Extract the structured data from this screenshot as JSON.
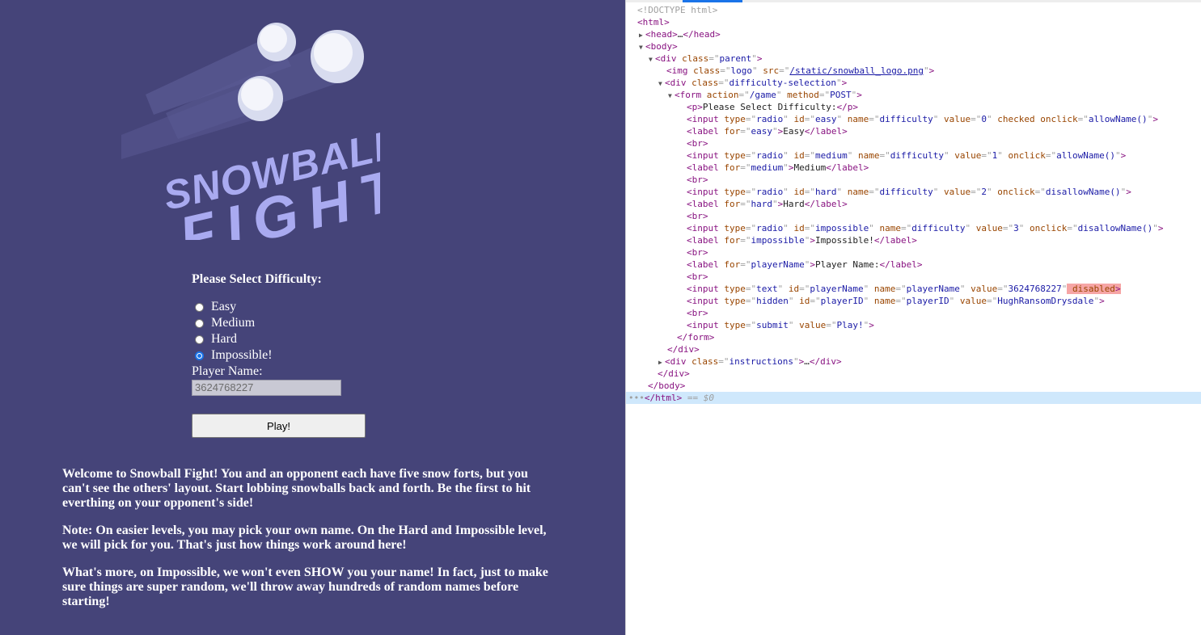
{
  "game": {
    "logo": {
      "line1": "SNOWBALL",
      "line2": "FIGHT"
    },
    "difficulty_prompt": "Please Select Difficulty:",
    "options": [
      {
        "label": "Easy",
        "checked": false
      },
      {
        "label": "Medium",
        "checked": false
      },
      {
        "label": "Hard",
        "checked": false
      },
      {
        "label": "Impossible!",
        "checked": true
      }
    ],
    "player_name_label": "Player Name:",
    "player_name_value": "3624768227",
    "play_button": "Play!",
    "instructions": [
      "Welcome to Snowball Fight! You and an opponent each have five snow forts, but you can't see the others' layout. Start lobbing snowballs back and forth. Be the first to hit everthing on your opponent's side!",
      "Note: On easier levels, you may pick your own name. On the Hard and Impossible level, we will pick for you. That's just how things work around here!",
      "What's more, on Impossible, we won't even SHOW you your name! In fact, just to make sure things are super random, we'll throw away hundreds of random names before starting!"
    ],
    "colors": {
      "background": "#454479",
      "logo": "#a9aaf0",
      "text": "#ffffff",
      "radio_checked": "#1a73e8"
    }
  },
  "devtools": {
    "doctype": "<!DOCTYPE html>",
    "lines": {
      "html_open": "html",
      "head": "head",
      "body_open": "body",
      "div_parent": {
        "tag": "div",
        "attr": "class",
        "value": "parent"
      },
      "img": {
        "tag": "img",
        "a1": "class",
        "v1": "logo",
        "a2": "src",
        "v2": "/static/snowball_logo.png"
      },
      "div_diff": {
        "tag": "div",
        "attr": "class",
        "value": "difficulty-selection"
      },
      "form": {
        "tag": "form",
        "a1": "action",
        "v1": "/game",
        "a2": "method",
        "v2": "POST"
      },
      "p": {
        "tag": "p",
        "text": "Please Select Difficulty:"
      },
      "inputs": [
        {
          "tag": "input",
          "type": "radio",
          "id": "easy",
          "name": "difficulty",
          "value": "0",
          "extra": "checked",
          "onclick": "allowName()"
        },
        {
          "tag": "input",
          "type": "radio",
          "id": "medium",
          "name": "difficulty",
          "value": "1",
          "onclick": "allowName()"
        },
        {
          "tag": "input",
          "type": "radio",
          "id": "hard",
          "name": "difficulty",
          "value": "2",
          "onclick": "disallowName()"
        },
        {
          "tag": "input",
          "type": "radio",
          "id": "impossible",
          "name": "difficulty",
          "value": "3",
          "onclick": "disallowName()"
        }
      ],
      "labels": [
        {
          "for": "easy",
          "text": "Easy"
        },
        {
          "for": "medium",
          "text": "Medium"
        },
        {
          "for": "hard",
          "text": "Hard"
        },
        {
          "for": "impossible",
          "text": "Impossible!"
        },
        {
          "for": "playerName",
          "text": "Player Name:"
        }
      ],
      "br": "br",
      "text_input": {
        "type": "text",
        "id": "playerName",
        "name": "playerName",
        "value": "3624768227",
        "flag": "disabled"
      },
      "hidden_input": {
        "type": "hidden",
        "id": "playerID",
        "name": "playerID",
        "value": "HughRansomDrysdale"
      },
      "submit_input": {
        "type": "submit",
        "value": "Play!"
      },
      "form_close": "form",
      "div_close": "div",
      "div_instructions": {
        "tag": "div",
        "attr": "class",
        "value": "instructions"
      },
      "body_close": "body",
      "html_close": "html",
      "selected_suffix": "== $0"
    }
  }
}
